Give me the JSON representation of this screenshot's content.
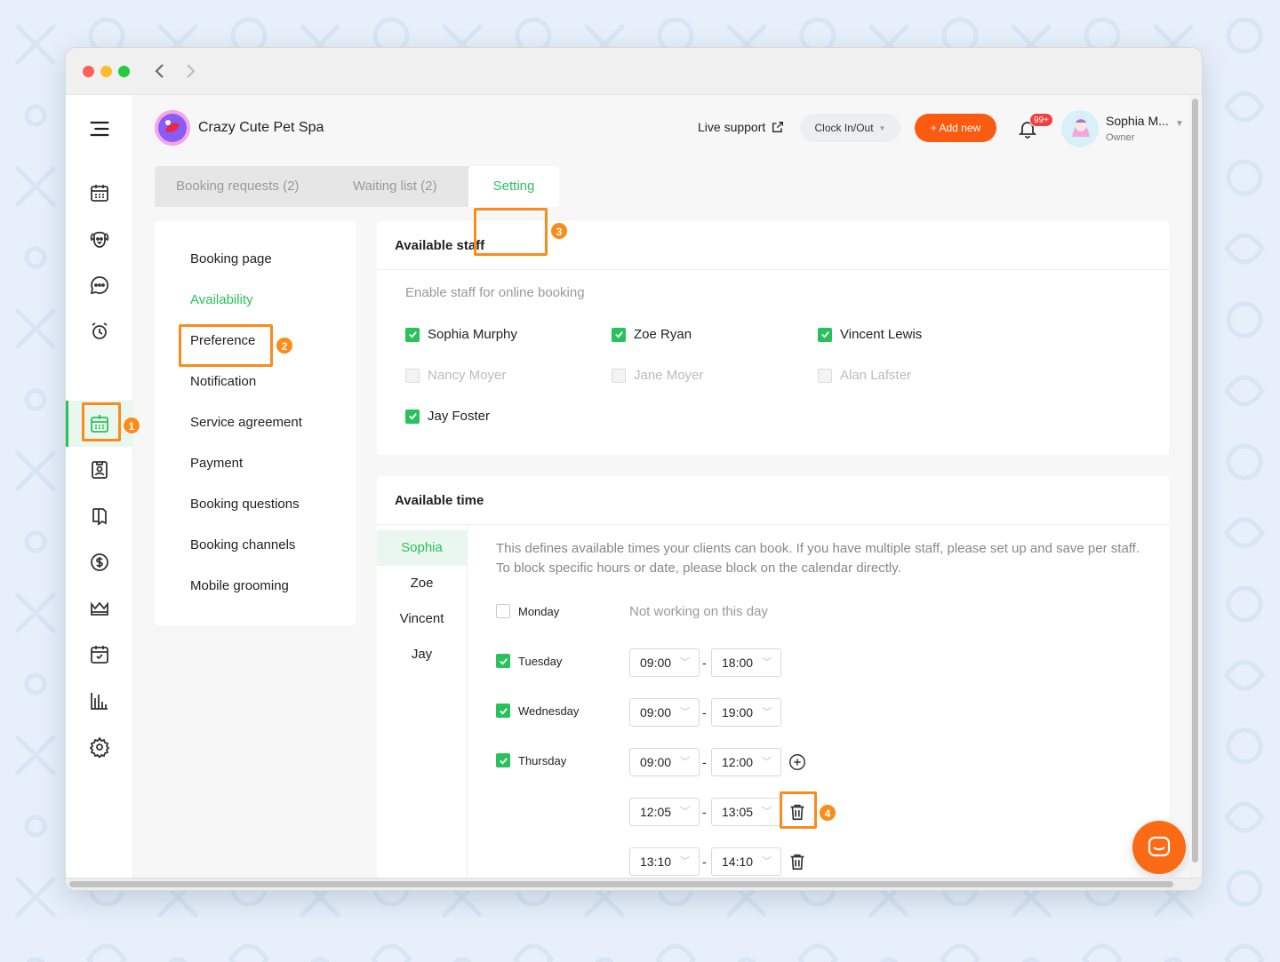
{
  "app": {
    "title": "Crazy Cute Pet Spa"
  },
  "header": {
    "live_support": "Live support",
    "clock_label": "Clock In/Out",
    "add_new": "+ Add new",
    "notif_badge": "99+",
    "user_name": "Sophia M...",
    "user_role": "Owner"
  },
  "sidebar": {
    "items": [
      "calendar-icon",
      "pet-icon",
      "chat-icon",
      "alarm-icon",
      "online-booking-icon",
      "client-card-icon",
      "notebook-icon",
      "dollar-icon",
      "crown-icon",
      "schedule-icon",
      "report-icon",
      "settings-icon"
    ],
    "active": "online-booking-icon"
  },
  "tabs": [
    {
      "label": "Booking requests (2)"
    },
    {
      "label": "Waiting list (2)"
    },
    {
      "label": "Setting"
    }
  ],
  "settings_menu": [
    "Booking page",
    "Availability",
    "Preference",
    "Notification",
    "Service agreement",
    "Payment",
    "Booking questions",
    "Booking channels",
    "Mobile grooming"
  ],
  "available_staff": {
    "title": "Available staff",
    "subtitle": "Enable staff for online booking",
    "staff": [
      {
        "name": "Sophia Murphy",
        "checked": true
      },
      {
        "name": "Zoe Ryan",
        "checked": true
      },
      {
        "name": "Vincent Lewis",
        "checked": true
      },
      {
        "name": "Nancy Moyer",
        "checked": false
      },
      {
        "name": "Jane Moyer",
        "checked": false
      },
      {
        "name": "Alan Lafster",
        "checked": false
      },
      {
        "name": "Jay Foster",
        "checked": true
      }
    ]
  },
  "available_time": {
    "title": "Available time",
    "staff_tabs": [
      "Sophia",
      "Zoe",
      "Vincent",
      "Jay"
    ],
    "description": "This defines available times your clients can book. If you have multiple staff, please set up and save per staff. To block specific hours or date, please block on the calendar directly.",
    "days": [
      {
        "day": "Monday",
        "checked": false,
        "note": "Not working on this day"
      },
      {
        "day": "Tuesday",
        "checked": true,
        "from": "09:00",
        "to": "18:00"
      },
      {
        "day": "Wednesday",
        "checked": true,
        "from": "09:00",
        "to": "19:00"
      },
      {
        "day": "Thursday",
        "checked": true,
        "from": "09:00",
        "to": "12:00"
      }
    ],
    "extra_slots": [
      {
        "from": "12:05",
        "to": "13:05"
      },
      {
        "from": "13:10",
        "to": "14:10"
      }
    ],
    "separator": "-"
  },
  "annotations": [
    "1",
    "2",
    "3",
    "4"
  ],
  "colors": {
    "accent_green": "#29c15c",
    "orange": "#fb8c1a",
    "add_button": "#fb5b10"
  }
}
